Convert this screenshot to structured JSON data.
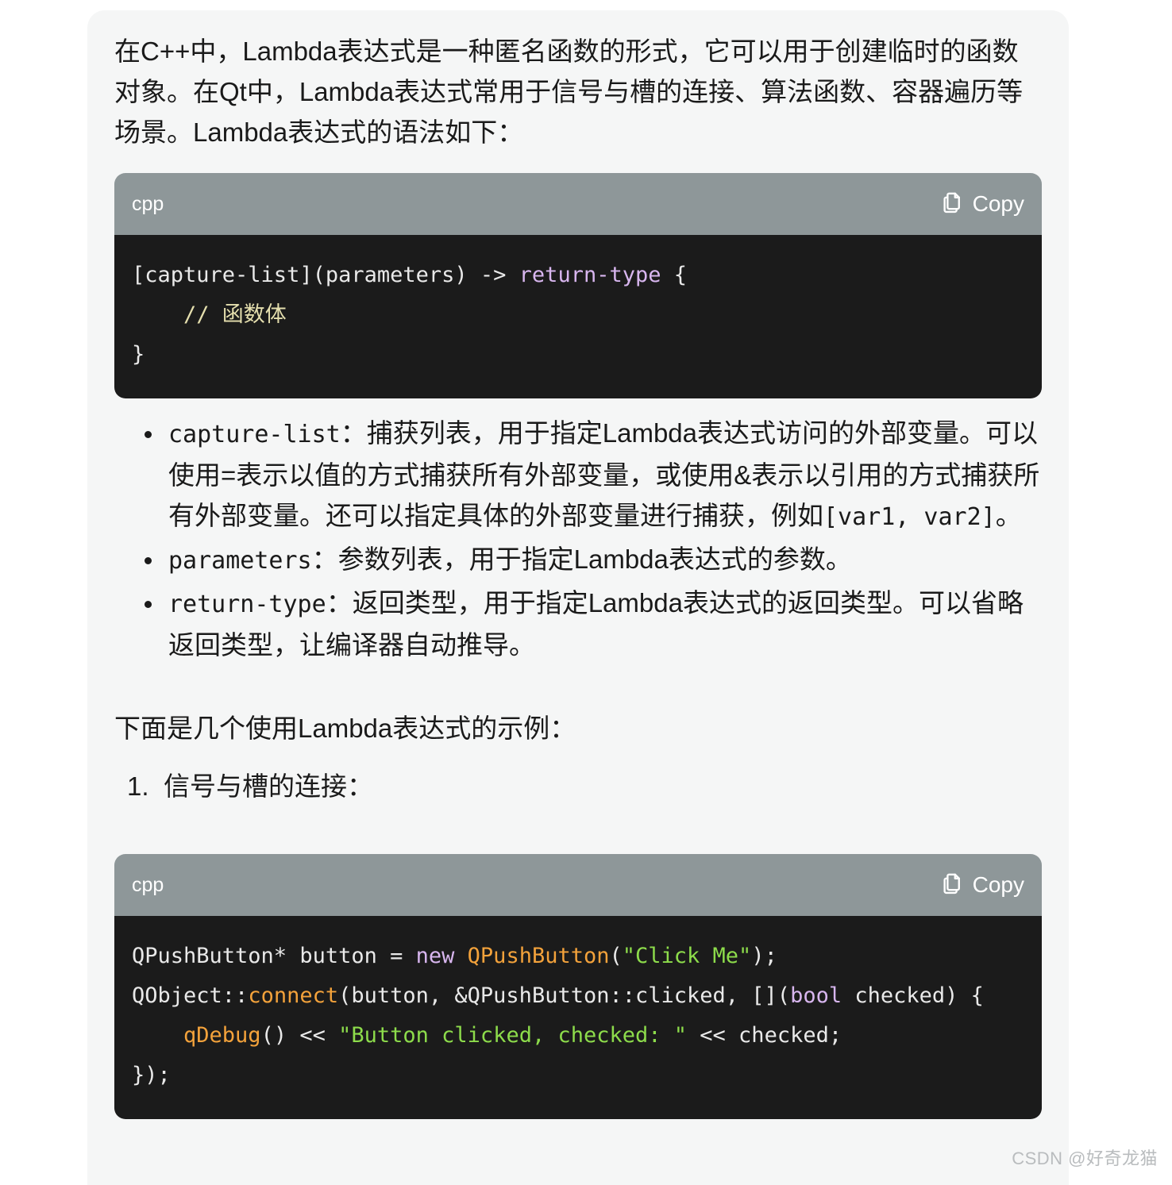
{
  "card": {
    "intro_paragraph": "在C++中，Lambda表达式是一种匿名函数的形式，它可以用于创建临时的函数对象。在Qt中，Lambda表达式常用于信号与槽的连接、算法函数、容器遍历等场景。Lambda表达式的语法如下：",
    "examples_lead": "下面是几个使用Lambda表达式的示例："
  },
  "code_blocks": [
    {
      "language": "cpp",
      "copy_label": "Copy",
      "copy_icon": "copy-icon",
      "lines": [
        [
          {
            "t": "[capture-list](parameters) -> ",
            "c": "plain"
          },
          {
            "t": "return-type",
            "c": "type"
          },
          {
            "t": " {",
            "c": "plain"
          }
        ],
        [
          {
            "t": "    ",
            "c": "plain"
          },
          {
            "t": "// 函数体",
            "c": "comment"
          }
        ],
        [
          {
            "t": "}",
            "c": "plain"
          }
        ]
      ]
    },
    {
      "language": "cpp",
      "copy_label": "Copy",
      "copy_icon": "copy-icon",
      "lines": [
        [
          {
            "t": "QPushButton* button = ",
            "c": "plain"
          },
          {
            "t": "new",
            "c": "kw"
          },
          {
            "t": " ",
            "c": "plain"
          },
          {
            "t": "QPushButton",
            "c": "cls"
          },
          {
            "t": "(",
            "c": "plain"
          },
          {
            "t": "\"Click Me\"",
            "c": "str"
          },
          {
            "t": ");",
            "c": "plain"
          }
        ],
        [
          {
            "t": "QObject::",
            "c": "plain"
          },
          {
            "t": "connect",
            "c": "fn"
          },
          {
            "t": "(button, &QPushButton::clicked, [](",
            "c": "plain"
          },
          {
            "t": "bool",
            "c": "kw"
          },
          {
            "t": " checked) {",
            "c": "plain"
          }
        ],
        [
          {
            "t": "    ",
            "c": "plain"
          },
          {
            "t": "qDebug",
            "c": "fn"
          },
          {
            "t": "() << ",
            "c": "plain"
          },
          {
            "t": "\"Button clicked, checked: \"",
            "c": "str"
          },
          {
            "t": " << checked;",
            "c": "plain"
          }
        ],
        [
          {
            "t": "});",
            "c": "plain"
          }
        ]
      ]
    }
  ],
  "syntax_bullets": [
    {
      "term": "capture-list",
      "description": "：捕获列表，用于指定Lambda表达式访问的外部变量。可以使用=表示以值的方式捕获所有外部变量，或使用&表示以引用的方式捕获所有外部变量。还可以指定具体的外部变量进行捕获，例如",
      "tail_code": "[var1, var2]",
      "tail_text": "。"
    },
    {
      "term": "parameters",
      "description": "：参数列表，用于指定Lambda表达式的参数。",
      "tail_code": "",
      "tail_text": ""
    },
    {
      "term": "return-type",
      "description": "：返回类型，用于指定Lambda表达式的返回类型。可以省略返回类型，让编译器自动推导。",
      "tail_code": "",
      "tail_text": ""
    }
  ],
  "example_items": [
    {
      "label": "信号与槽的连接："
    }
  ],
  "watermark": {
    "text": "CSDN @好奇龙猫"
  },
  "colors": {
    "page_background": "#ffffff",
    "card_background": "#f5f6f6",
    "code_header": "#8e9799",
    "code_background": "#1b1b1b",
    "text": "#1a1a1a",
    "token_type": "#d8b6ef",
    "token_keyword": "#d8b6ef",
    "token_comment": "#e5dfae",
    "token_function": "#f3a23b",
    "token_class": "#f3a23b",
    "token_string": "#8ddc4b",
    "watermark": "#b9bcbe"
  }
}
